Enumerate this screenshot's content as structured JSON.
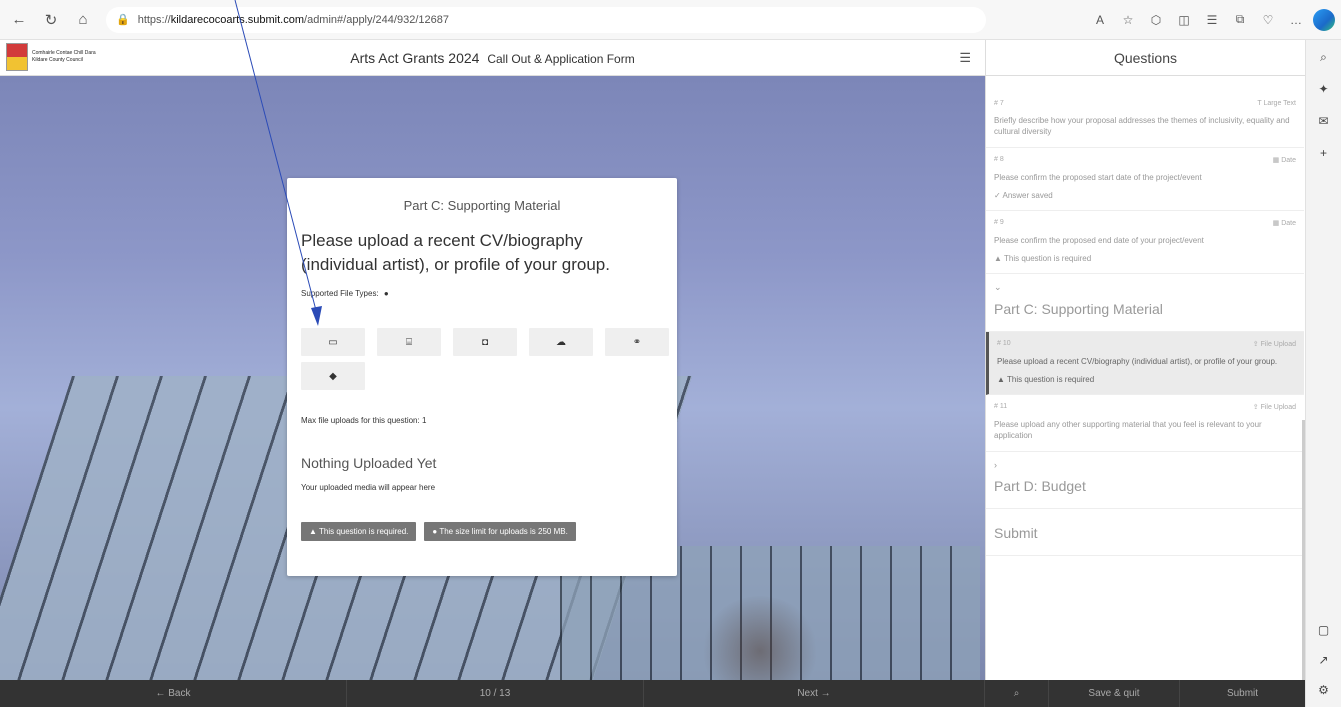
{
  "browser": {
    "url_prefix": "https://",
    "url_host": "kildarecocoarts.submit.com",
    "url_path": "/admin#/apply/244/932/12687"
  },
  "logo": {
    "line1": "Comhairle Contae Chill Dara",
    "line2": "Kildare County Council"
  },
  "header": {
    "title": "Arts Act Grants 2024",
    "subtitle": "Call Out & Application Form"
  },
  "card": {
    "section": "Part C: Supporting Material",
    "question": "Please upload a recent CV/biography (individual artist), or profile of your group.",
    "file_types_label": "Supported File Types:",
    "max_uploads": "Max file uploads for this question: 1",
    "nothing_uploaded": "Nothing Uploaded Yet",
    "media_hint": "Your uploaded media will appear here",
    "required_badge": "This question is required.",
    "size_badge": "The size limit for uploads is 250 MB."
  },
  "panel": {
    "title": "Questions",
    "items": [
      {
        "num": "# 7",
        "type": "Large Text",
        "text": "Briefly describe how your proposal addresses the themes of inclusivity, equality and cultural diversity",
        "status": ""
      },
      {
        "num": "# 8",
        "type": "Date",
        "text": "Please confirm the proposed start date of the project/event",
        "status": "Answer saved"
      },
      {
        "num": "# 9",
        "type": "Date",
        "text": "Please confirm the proposed end date of your project/event",
        "status": "This question is required"
      },
      {
        "num": "# 10",
        "type": "File Upload",
        "text": "Please upload a recent CV/biography (individual artist), or profile of your group.",
        "status": "This question is required"
      },
      {
        "num": "# 11",
        "type": "File Upload",
        "text": "Please upload any other supporting material that you feel is relevant to your application",
        "status": ""
      }
    ],
    "part_c": "Part C: Supporting Material",
    "part_d": "Part D: Budget",
    "submit": "Submit"
  },
  "footer": {
    "back": "Back",
    "page": "10 / 13",
    "next": "Next",
    "save": "Save & quit",
    "submit": "Submit"
  }
}
